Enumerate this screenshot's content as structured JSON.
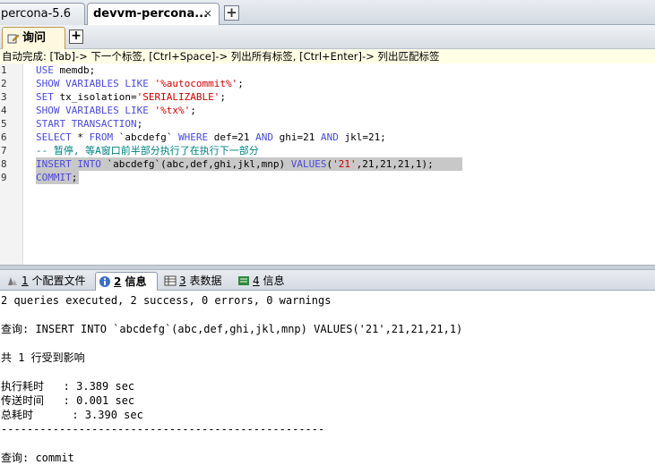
{
  "connection_tabs": [
    {
      "label": "percona-5.6"
    },
    {
      "label": "devvm-percona..."
    }
  ],
  "connection_add_label": "+",
  "query_tab": {
    "label": "询问"
  },
  "query_add_label": "+",
  "hint": "自动完成: [Tab]-> 下一个标签, [Ctrl+Space]-> 列出所有标签, [Ctrl+Enter]-> 列出匹配标签",
  "editor": {
    "line_numbers": [
      "1",
      "2",
      "3",
      "4",
      "5",
      "6",
      "7",
      "8",
      "9"
    ],
    "lines": [
      [
        {
          "t": "USE",
          "c": "kw"
        },
        {
          "t": " memdb;",
          "c": ""
        }
      ],
      [
        {
          "t": "SHOW VARIABLES LIKE",
          "c": "kw"
        },
        {
          "t": " ",
          "c": ""
        },
        {
          "t": "'%autocommit%'",
          "c": "str"
        },
        {
          "t": ";",
          "c": ""
        }
      ],
      [
        {
          "t": "SET",
          "c": "kw"
        },
        {
          "t": " tx_isolation=",
          "c": ""
        },
        {
          "t": "'SERIALIZABLE'",
          "c": "str"
        },
        {
          "t": ";",
          "c": ""
        }
      ],
      [
        {
          "t": "SHOW VARIABLES LIKE",
          "c": "kw"
        },
        {
          "t": " ",
          "c": ""
        },
        {
          "t": "'%tx%'",
          "c": "str"
        },
        {
          "t": ";",
          "c": ""
        }
      ],
      [
        {
          "t": "START TRANSACTION",
          "c": "kw"
        },
        {
          "t": ";",
          "c": ""
        }
      ],
      [
        {
          "t": "SELECT",
          "c": "kw"
        },
        {
          "t": " * ",
          "c": ""
        },
        {
          "t": "FROM",
          "c": "kw"
        },
        {
          "t": " `abcdefg` ",
          "c": ""
        },
        {
          "t": "WHERE",
          "c": "kw"
        },
        {
          "t": " def=21 ",
          "c": ""
        },
        {
          "t": "AND",
          "c": "kw"
        },
        {
          "t": " ghi=21 ",
          "c": ""
        },
        {
          "t": "AND",
          "c": "kw"
        },
        {
          "t": " jkl=21;",
          "c": ""
        }
      ],
      [
        {
          "t": "-- 暂停, 等A窗口前半部分执行了在执行下一部分",
          "c": "cm"
        }
      ],
      [
        {
          "t": "INSERT INTO",
          "c": "kw"
        },
        {
          "t": " `abcdefg`(abc,def,ghi,jkl,mnp) ",
          "c": ""
        },
        {
          "t": "VALUES",
          "c": "kw"
        },
        {
          "t": "(",
          "c": ""
        },
        {
          "t": "'21'",
          "c": "str"
        },
        {
          "t": ",21,21,21,1);",
          "c": ""
        }
      ],
      [
        {
          "t": "COMMIT",
          "c": "kw"
        },
        {
          "t": ";",
          "c": ""
        }
      ]
    ]
  },
  "result_tabs": [
    {
      "num": "1",
      "label": " 个配置文件",
      "icon": "profile-icon"
    },
    {
      "num": "2",
      "label": " 信息",
      "icon": "info-icon",
      "active": true
    },
    {
      "num": "3",
      "label": " 表数据",
      "icon": "table-icon"
    },
    {
      "num": "4",
      "label": " 信息",
      "icon": "info-list-icon"
    }
  ],
  "output_lines": [
    "2 queries executed, 2 success, 0 errors, 0 warnings",
    "",
    "查询: INSERT INTO `abcdefg`(abc,def,ghi,jkl,mnp) VALUES('21',21,21,21,1)",
    "",
    "共 1 行受到影响",
    "",
    "执行耗时   : 3.389 sec",
    "传送时间   : 0.001 sec",
    "总耗时      : 3.390 sec",
    "--------------------------------------------------",
    "",
    "查询: commit"
  ],
  "colors": {
    "keyword": "#4a4ad8",
    "string": "#cc0000",
    "comment": "#008080",
    "selection": "#c8c8c8"
  }
}
